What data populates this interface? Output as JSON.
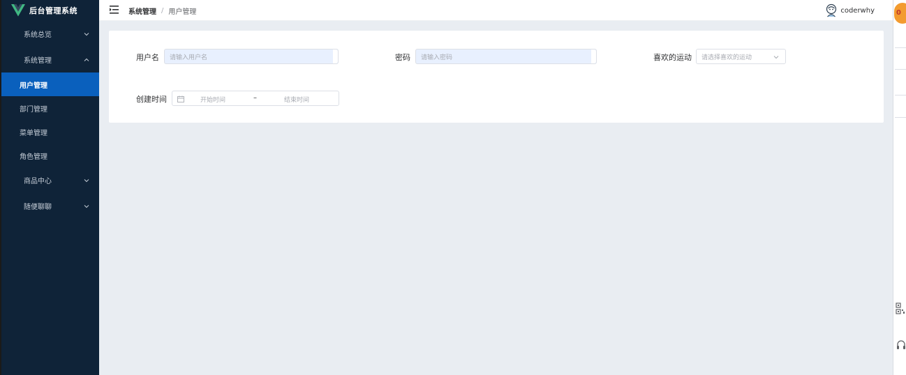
{
  "app": {
    "title": "后台管理系统",
    "logo_icon": "vue-logo-icon"
  },
  "sidebar": {
    "groups": [
      {
        "label": "系统总览",
        "expanded": false
      },
      {
        "label": "系统管理",
        "expanded": true
      },
      {
        "label": "商品中心",
        "expanded": false
      },
      {
        "label": "随便聊聊",
        "expanded": false
      }
    ],
    "system_sub_items": [
      {
        "label": "用户管理",
        "active": true
      },
      {
        "label": "部门管理",
        "active": false
      },
      {
        "label": "菜单管理",
        "active": false
      },
      {
        "label": "角色管理",
        "active": false
      }
    ]
  },
  "header": {
    "fold_icon": "menu-fold-icon",
    "breadcrumb": [
      "系统管理",
      "用户管理"
    ],
    "breadcrumb_separator": "/",
    "username": "coderwhy",
    "avatar_icon": "avatar-icon"
  },
  "search_form": {
    "username": {
      "label": "用户名",
      "placeholder": "请输入用户名",
      "value": ""
    },
    "password": {
      "label": "密码",
      "placeholder": "请输入密码",
      "value": ""
    },
    "sport": {
      "label": "喜欢的运动",
      "placeholder": "请选择喜欢的运动",
      "value": ""
    },
    "create_time": {
      "label": "创建时间",
      "start_placeholder": "开始时间",
      "end_placeholder": "结束时间",
      "separator": "–"
    }
  },
  "browser_strip": {
    "badge_text": "0"
  },
  "colors": {
    "sidebar_bg": "#0f2338",
    "active_item_bg": "#0a60bd",
    "page_bg": "#e9edf2",
    "autofill_bg": "#e8f0fe"
  }
}
